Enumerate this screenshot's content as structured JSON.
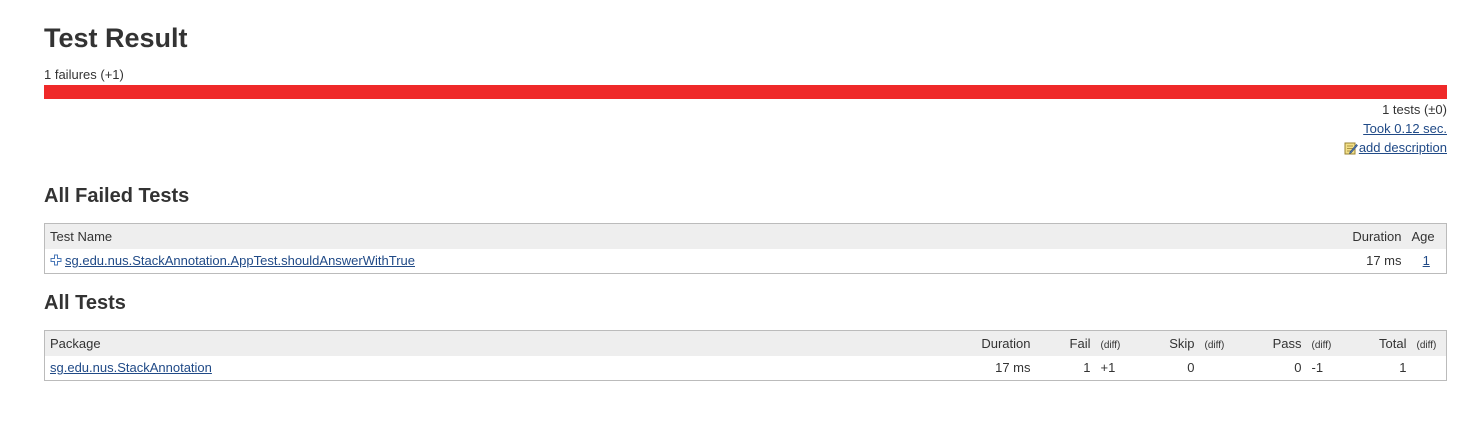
{
  "header": {
    "title": "Test Result",
    "failures_summary": "1 failures (+1)"
  },
  "progress": {
    "failed_fraction": 1.0,
    "fail_color": "#ef2929",
    "pass_color": "#729fcf"
  },
  "summary": {
    "tests_count": "1 tests (±0)",
    "took": "Took 0.12 sec.",
    "add_description": "add description"
  },
  "failed_tests": {
    "heading": "All Failed Tests",
    "columns": {
      "name": "Test Name",
      "duration": "Duration",
      "age": "Age"
    },
    "rows": [
      {
        "name": "sg.edu.nus.StackAnnotation.AppTest.shouldAnswerWithTrue",
        "duration": "17 ms",
        "age": "1"
      }
    ]
  },
  "all_tests": {
    "heading": "All Tests",
    "columns": {
      "package": "Package",
      "duration": "Duration",
      "fail": "Fail",
      "skip": "Skip",
      "pass": "Pass",
      "total": "Total",
      "diff": "(diff)"
    },
    "rows": [
      {
        "package": "sg.edu.nus.StackAnnotation",
        "duration": "17 ms",
        "fail": "1",
        "fail_diff": "+1",
        "skip": "0",
        "skip_diff": "",
        "pass": "0",
        "pass_diff": "-1",
        "total": "1",
        "total_diff": ""
      }
    ]
  }
}
